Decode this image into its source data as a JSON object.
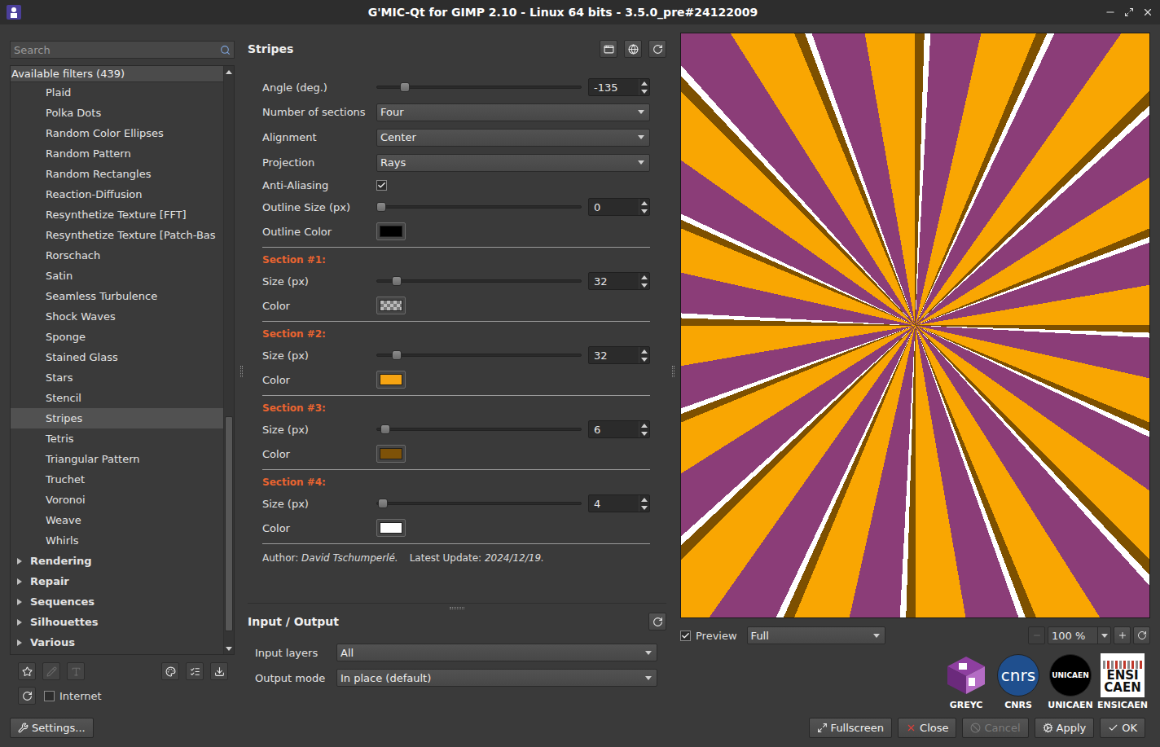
{
  "window": {
    "title": "G'MIC-Qt for GIMP 2.10 - Linux 64 bits - 3.5.0_pre#24122009"
  },
  "filters": {
    "search_placeholder": "Search",
    "header": "Available filters (439)",
    "items": [
      {
        "label": "Plaid",
        "kind": "filter",
        "selected": false
      },
      {
        "label": "Polka Dots",
        "kind": "filter",
        "selected": false
      },
      {
        "label": "Random Color Ellipses",
        "kind": "filter",
        "selected": false
      },
      {
        "label": "Random Pattern",
        "kind": "filter",
        "selected": false
      },
      {
        "label": "Random Rectangles",
        "kind": "filter",
        "selected": false
      },
      {
        "label": "Reaction-Diffusion",
        "kind": "filter",
        "selected": false
      },
      {
        "label": "Resynthetize Texture [FFT]",
        "kind": "filter",
        "selected": false
      },
      {
        "label": "Resynthetize Texture [Patch-Bas",
        "kind": "filter",
        "selected": false
      },
      {
        "label": "Rorschach",
        "kind": "filter",
        "selected": false
      },
      {
        "label": "Satin",
        "kind": "filter",
        "selected": false
      },
      {
        "label": "Seamless Turbulence",
        "kind": "filter",
        "selected": false
      },
      {
        "label": "Shock Waves",
        "kind": "filter",
        "selected": false
      },
      {
        "label": "Sponge",
        "kind": "filter",
        "selected": false
      },
      {
        "label": "Stained Glass",
        "kind": "filter",
        "selected": false
      },
      {
        "label": "Stars",
        "kind": "filter",
        "selected": false
      },
      {
        "label": "Stencil",
        "kind": "filter",
        "selected": false
      },
      {
        "label": "Stripes",
        "kind": "filter",
        "selected": true
      },
      {
        "label": "Tetris",
        "kind": "filter",
        "selected": false
      },
      {
        "label": "Triangular Pattern",
        "kind": "filter",
        "selected": false
      },
      {
        "label": "Truchet",
        "kind": "filter",
        "selected": false
      },
      {
        "label": "Voronoi",
        "kind": "filter",
        "selected": false
      },
      {
        "label": "Weave",
        "kind": "filter",
        "selected": false
      },
      {
        "label": "Whirls",
        "kind": "filter",
        "selected": false
      },
      {
        "label": "Rendering",
        "kind": "category",
        "expanded": false,
        "selected": false
      },
      {
        "label": "Repair",
        "kind": "category",
        "expanded": false,
        "selected": false
      },
      {
        "label": "Sequences",
        "kind": "category",
        "expanded": false,
        "selected": false
      },
      {
        "label": "Silhouettes",
        "kind": "category",
        "expanded": false,
        "selected": false
      },
      {
        "label": "Various",
        "kind": "category",
        "expanded": false,
        "selected": false
      }
    ],
    "scrollbar": {
      "position": 0.6,
      "size": 0.38
    },
    "tools": [
      {
        "disabled": false
      },
      {
        "disabled": true
      },
      {
        "disabled": true
      },
      {
        "disabled": false
      },
      {
        "disabled": false
      },
      {
        "disabled": false
      }
    ],
    "internet": {
      "label": "Internet",
      "checked": false
    }
  },
  "filter": {
    "title": "Stripes",
    "params": [
      {
        "kind": "slider",
        "label": "Angle (deg.)",
        "value": "-135",
        "level": 0.12
      },
      {
        "kind": "select",
        "label": "Number of sections",
        "value": "Four"
      },
      {
        "kind": "select",
        "label": "Alignment",
        "value": "Center"
      },
      {
        "kind": "select",
        "label": "Projection",
        "value": "Rays"
      },
      {
        "kind": "checkbox",
        "label": "Anti-Aliasing",
        "checked": true
      },
      {
        "kind": "slider",
        "label": "Outline Size (px)",
        "value": "0",
        "level": 0
      },
      {
        "kind": "color",
        "label": "Outline Color",
        "color": "#000000"
      },
      {
        "kind": "separator"
      },
      {
        "kind": "section",
        "label": "Section #1:"
      },
      {
        "kind": "slider",
        "label": "Size (px)",
        "value": "32",
        "level": 0.08
      },
      {
        "kind": "color",
        "label": "Color",
        "color": "#00000000"
      },
      {
        "kind": "separator"
      },
      {
        "kind": "section",
        "label": "Section #2:"
      },
      {
        "kind": "slider",
        "label": "Size (px)",
        "value": "32",
        "level": 0.08
      },
      {
        "kind": "color",
        "label": "Color",
        "color": "#f6a412"
      },
      {
        "kind": "separator"
      },
      {
        "kind": "section",
        "label": "Section #3:"
      },
      {
        "kind": "slider",
        "label": "Size (px)",
        "value": "6",
        "level": 0.02
      },
      {
        "kind": "color",
        "label": "Color",
        "color": "#7e5208"
      },
      {
        "kind": "separator"
      },
      {
        "kind": "section",
        "label": "Section #4:"
      },
      {
        "kind": "slider",
        "label": "Size (px)",
        "value": "4",
        "level": 0.01
      },
      {
        "kind": "color",
        "label": "Color",
        "color": "#ffffff"
      },
      {
        "kind": "separator"
      }
    ],
    "author": {
      "author_label": "Author:",
      "author": "David Tschumperlé.",
      "update_label": "Latest Update:",
      "update": "2024/12/19."
    }
  },
  "io": {
    "title": "Input / Output",
    "rows": [
      {
        "label": "Input layers",
        "value": "All"
      },
      {
        "label": "Output mode",
        "value": "In place (default)"
      }
    ]
  },
  "preview": {
    "label": "Preview",
    "checked": true,
    "mode": "Full",
    "zoom": "100 %",
    "zoom_out_disabled": true
  },
  "logos": [
    {
      "kind": "greyc",
      "mark": [],
      "caption": "GREYC"
    },
    {
      "kind": "cnrs",
      "mark": [
        "cnrs"
      ],
      "caption": "CNRS"
    },
    {
      "kind": "unicaen",
      "mark": [
        "UNICAEN"
      ],
      "caption": "UNICAEN"
    },
    {
      "kind": "ensicaen",
      "mark": [
        "ENSI",
        "CAEN"
      ],
      "caption": "ENSICAEN"
    }
  ],
  "settings_button": "Settings...",
  "buttons": [
    {
      "label": "Fullscreen",
      "disabled": false
    },
    {
      "label": "Close",
      "disabled": false
    },
    {
      "label": "Cancel",
      "disabled": true
    },
    {
      "label": "Apply",
      "disabled": false
    },
    {
      "label": "OK",
      "disabled": false
    }
  ]
}
